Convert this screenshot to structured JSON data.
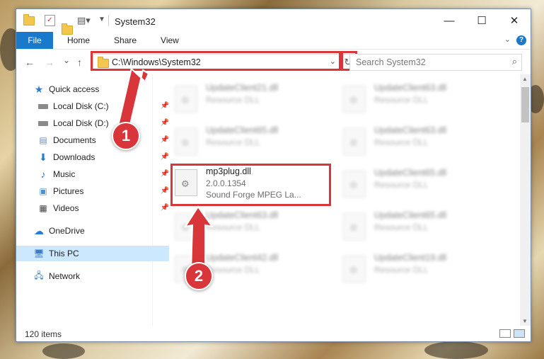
{
  "window": {
    "title": "System32",
    "controls": {
      "minimize": "—",
      "maximize": "☐",
      "close": "✕"
    }
  },
  "ribbon": {
    "tabs": [
      "File",
      "Home",
      "Share",
      "View"
    ],
    "help": "?"
  },
  "navigation": {
    "back": "←",
    "forward": "→",
    "recent": "⌄",
    "up": "↑",
    "address": "C:\\Windows\\System32",
    "refresh": "↻",
    "search_placeholder": "Search System32"
  },
  "sidebar": {
    "items": [
      {
        "label": "Quick access",
        "icon": "star-icon"
      },
      {
        "label": "Local Disk (C:)",
        "icon": "drive-icon",
        "pinned": true
      },
      {
        "label": "Local Disk (D:)",
        "icon": "drive-icon",
        "pinned": true
      },
      {
        "label": "Documents",
        "icon": "documents-icon",
        "pinned": true
      },
      {
        "label": "Downloads",
        "icon": "download-icon",
        "pinned": true
      },
      {
        "label": "Music",
        "icon": "music-icon",
        "pinned": true
      },
      {
        "label": "Pictures",
        "icon": "pictures-icon",
        "pinned": true
      },
      {
        "label": "Videos",
        "icon": "videos-icon",
        "pinned": true
      },
      {
        "label": "OneDrive",
        "icon": "cloud-icon"
      },
      {
        "label": "This PC",
        "icon": "computer-icon",
        "selected": true
      },
      {
        "label": "Network",
        "icon": "network-icon"
      }
    ]
  },
  "files": [
    {
      "name": "UpdateClient21.dll",
      "line2": "Resource DLL",
      "line3": ""
    },
    {
      "name": "UpdateClient63.dll",
      "line2": "Resource DLL",
      "line3": ""
    },
    {
      "name": "UpdateClient65.dll",
      "line2": "Resource DLL",
      "line3": ""
    },
    {
      "name": "UpdateClient63.dll",
      "line2": "Resource DLL",
      "line3": ""
    },
    {
      "name": "mp3plug.dll",
      "line2": "2.0.0.1354",
      "line3": "Sound Forge MPEG La..."
    },
    {
      "name": "UpdateClient65.dll",
      "line2": "Resource DLL",
      "line3": ""
    },
    {
      "name": "UpdateClient63.dll",
      "line2": "Resource DLL",
      "line3": ""
    },
    {
      "name": "UpdateClient65.dll",
      "line2": "Resource DLL",
      "line3": ""
    },
    {
      "name": "UpdateClient42.dll",
      "line2": "Resource DLL",
      "line3": ""
    },
    {
      "name": "UpdateClient19.dll",
      "line2": "Resource DLL",
      "line3": ""
    }
  ],
  "status": {
    "item_count": "120 items"
  },
  "annotations": {
    "callout1": "1",
    "callout2": "2",
    "color": "#d8363a"
  }
}
